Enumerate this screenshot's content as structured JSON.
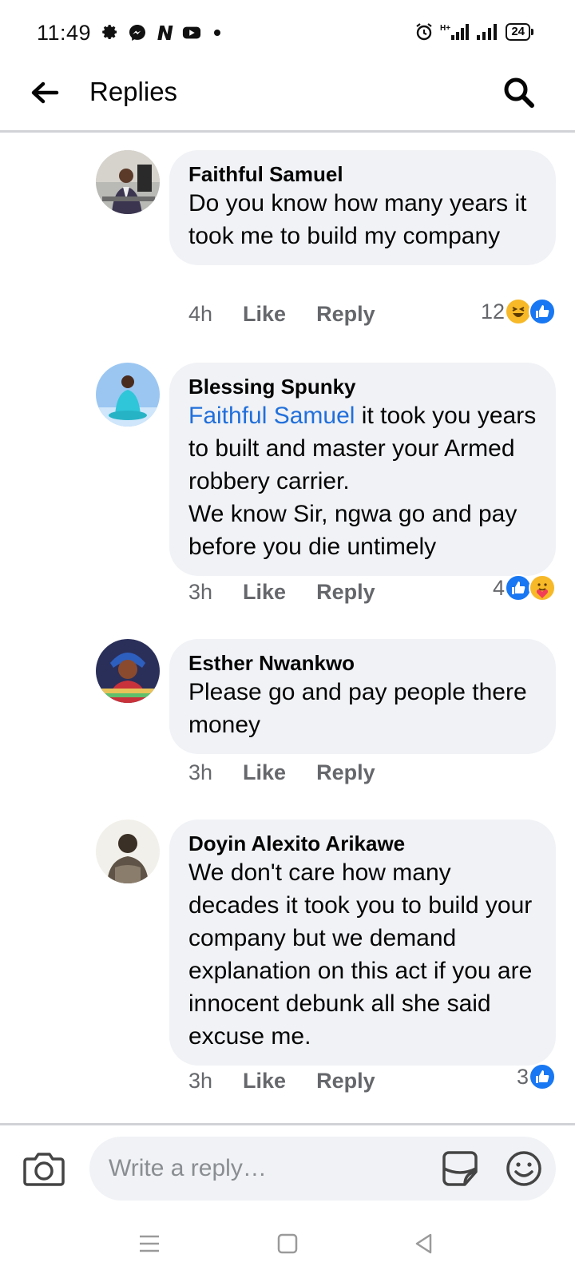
{
  "status_bar": {
    "time": "11:49",
    "battery": "24",
    "left_icons": [
      "gear-icon",
      "messenger-icon",
      "netflix-icon",
      "youtube-icon",
      "dot-icon"
    ],
    "right_icons": [
      "alarm-icon",
      "signal-hplus-icon",
      "signal-icon",
      "battery-icon"
    ]
  },
  "header": {
    "title": "Replies"
  },
  "colors": {
    "bubble": "#f0f2f5",
    "mention": "#216fdb",
    "meta": "#65676b",
    "like_blue": "#1877f2",
    "haha_yellow": "#f7b928"
  },
  "comments": [
    {
      "author": "Faithful Samuel",
      "text": "Do you know how many years it took me to build my company",
      "time": "4h",
      "like_label": "Like",
      "reply_label": "Reply",
      "reaction_count": "12",
      "reactions": [
        "haha-icon",
        "like-icon"
      ]
    },
    {
      "author": "Blessing Spunky",
      "mention": "Faithful Samuel",
      "text": " it took you years to built and master your Armed robbery carrier.",
      "text2": "We know Sir, ngwa go and pay before you die untimely",
      "time": "3h",
      "like_label": "Like",
      "reply_label": "Reply",
      "reaction_count": "4",
      "reactions": [
        "like-icon",
        "care-icon"
      ]
    },
    {
      "author": "Esther Nwankwo",
      "text": "Please go and pay people there  money",
      "time": "3h",
      "like_label": "Like",
      "reply_label": "Reply"
    },
    {
      "author": "Doyin Alexito Arikawe",
      "text": "We don't care how many decades it took you to build your company but we demand explanation on this act if you are innocent debunk all she said excuse me.",
      "time": "3h",
      "like_label": "Like",
      "reply_label": "Reply",
      "reaction_count": "3",
      "reactions": [
        "like-icon"
      ]
    }
  ],
  "reply_bar": {
    "placeholder": "Write a reply…"
  }
}
